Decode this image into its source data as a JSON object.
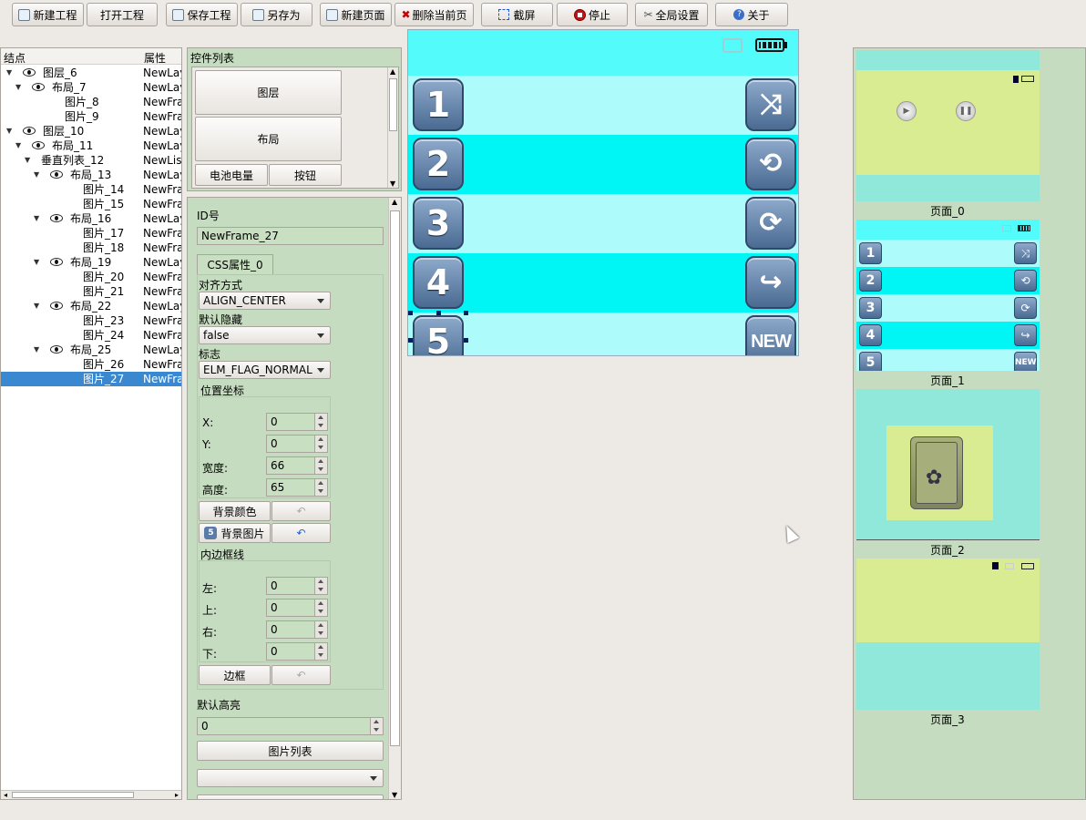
{
  "toolbar": {
    "new_project": "新建工程",
    "open_project": "打开工程",
    "save_project": "保存工程",
    "save_as": "另存为",
    "new_page": "新建页面",
    "delete_page": "删除当前页",
    "screenshot": "截屏",
    "stop": "停止",
    "global_settings": "全局设置",
    "about": "关于"
  },
  "tree": {
    "col_node": "结点",
    "col_attr": "属性",
    "rows": [
      {
        "name": "图层_6",
        "attr": "NewLay"
      },
      {
        "name": "布局_7",
        "attr": "NewLay"
      },
      {
        "name": "图片_8",
        "attr": "NewFra"
      },
      {
        "name": "图片_9",
        "attr": "NewFra"
      },
      {
        "name": "图层_10",
        "attr": "NewLay"
      },
      {
        "name": "布局_11",
        "attr": "NewLay"
      },
      {
        "name": "垂直列表_12",
        "attr": "NewLis"
      },
      {
        "name": "布局_13",
        "attr": "NewLay"
      },
      {
        "name": "图片_14",
        "attr": "NewFra"
      },
      {
        "name": "图片_15",
        "attr": "NewFra"
      },
      {
        "name": "布局_16",
        "attr": "NewLay"
      },
      {
        "name": "图片_17",
        "attr": "NewFra"
      },
      {
        "name": "图片_18",
        "attr": "NewFra"
      },
      {
        "name": "布局_19",
        "attr": "NewLay"
      },
      {
        "name": "图片_20",
        "attr": "NewFra"
      },
      {
        "name": "图片_21",
        "attr": "NewFra"
      },
      {
        "name": "布局_22",
        "attr": "NewLay"
      },
      {
        "name": "图片_23",
        "attr": "NewFra"
      },
      {
        "name": "图片_24",
        "attr": "NewFra"
      },
      {
        "name": "布局_25",
        "attr": "NewLay"
      },
      {
        "name": "图片_26",
        "attr": "NewFra"
      },
      {
        "name": "图片_27",
        "attr": "NewFra"
      }
    ]
  },
  "widgets": {
    "title": "控件列表",
    "layer": "图层",
    "layout": "布局",
    "battery": "电池电量",
    "button": "按钮"
  },
  "props": {
    "id_label": "ID号",
    "id_value": "NewFrame_27",
    "css_tab": "CSS属性_0",
    "align_label": "对齐方式",
    "align_value": "ALIGN_CENTER",
    "hidden_label": "默认隐藏",
    "hidden_value": "false",
    "flag_label": "标志",
    "flag_value": "ELM_FLAG_NORMAL",
    "pos_group": "位置坐标",
    "x_label": "X:",
    "x_value": "0",
    "y_label": "Y:",
    "y_value": "0",
    "w_label": "宽度:",
    "w_value": "66",
    "h_label": "高度:",
    "h_value": "65",
    "bg_color": "背景颜色",
    "bg_image": "背景图片",
    "padding_group": "内边框线",
    "left_label": "左:",
    "left_value": "0",
    "top_label": "上:",
    "top_value": "0",
    "right_label": "右:",
    "right_value": "0",
    "bottom_label": "下:",
    "bottom_value": "0",
    "border": "边框",
    "highlight_label": "默认高亮",
    "highlight_value": "0",
    "image_list": "图片列表",
    "image_combo": ""
  },
  "phone": {
    "rows": [
      {
        "num": "1",
        "icon": "⤨"
      },
      {
        "num": "2",
        "icon": "⟲"
      },
      {
        "num": "3",
        "icon": "⟳"
      },
      {
        "num": "4",
        "icon": "↪"
      },
      {
        "num": "5",
        "icon": "NEW"
      }
    ],
    "row_colors": [
      "#adfbfb",
      "#00f5f5",
      "#adfbfb",
      "#00f5f5",
      "#adfbfb"
    ]
  },
  "pages": {
    "p0": "页面_0",
    "p1": "页面_1",
    "p2": "页面_2",
    "p3": "页面_3"
  }
}
